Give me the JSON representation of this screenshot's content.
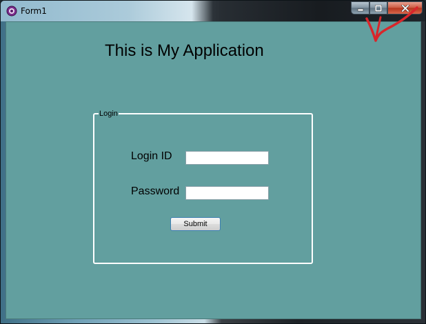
{
  "window": {
    "title": "Form1",
    "minimize_glyph": "▬",
    "maximize_glyph": "▢",
    "close_glyph": "X"
  },
  "app": {
    "heading": "This is My Application"
  },
  "login_group": {
    "legend": "Login",
    "login_id_label": "Login ID",
    "login_id_value": "",
    "password_label": "Password",
    "password_value": "",
    "submit_label": "Submit"
  },
  "colors": {
    "client_background": "#629f9f",
    "annotation_stroke": "#d8262b",
    "groupbox_border": "#ffffff"
  },
  "icons": {
    "app": "app-icon",
    "minimize": "minimize-icon",
    "maximize": "maximize-icon",
    "close": "close-icon"
  }
}
